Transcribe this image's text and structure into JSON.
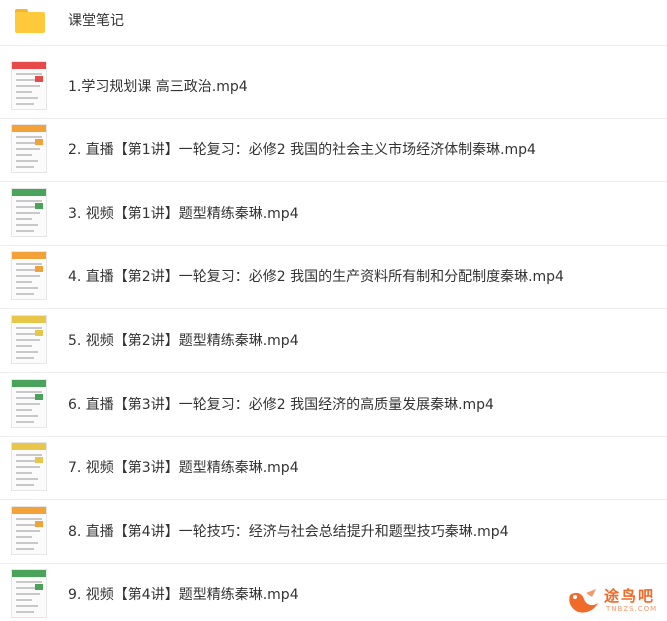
{
  "folder": {
    "name": "课堂笔记",
    "icon": "folder-icon",
    "color": "#ffc93c"
  },
  "files": [
    {
      "name": "1.学习规划课 高三政治.mp4",
      "icon": "video-thumbnail-icon",
      "accent": "#e84a4a"
    },
    {
      "name": "2. 直播【第1讲】一轮复习：必修2 我国的社会主义市场经济体制秦琳.mp4",
      "icon": "video-thumbnail-icon",
      "accent": "#f3a23a"
    },
    {
      "name": "3. 视频【第1讲】题型精练秦琳.mp4",
      "icon": "video-thumbnail-icon",
      "accent": "#4aa35a"
    },
    {
      "name": "4. 直播【第2讲】一轮复习：必修2 我国的生产资料所有制和分配制度秦琳.mp4",
      "icon": "video-thumbnail-icon",
      "accent": "#f3a23a"
    },
    {
      "name": "5. 视频【第2讲】题型精练秦琳.mp4",
      "icon": "video-thumbnail-icon",
      "accent": "#e8c64a"
    },
    {
      "name": "6. 直播【第3讲】一轮复习：必修2 我国经济的高质量发展秦琳.mp4",
      "icon": "video-thumbnail-icon",
      "accent": "#4aa35a"
    },
    {
      "name": "7. 视频【第3讲】题型精练秦琳.mp4",
      "icon": "video-thumbnail-icon",
      "accent": "#e8c64a"
    },
    {
      "name": "8. 直播【第4讲】一轮技巧：经济与社会总结提升和题型技巧秦琳.mp4",
      "icon": "video-thumbnail-icon",
      "accent": "#f3a23a"
    },
    {
      "name": "9. 视频【第4讲】题型精练秦琳.mp4",
      "icon": "video-thumbnail-icon",
      "accent": "#4aa35a"
    }
  ],
  "watermark": {
    "text": "途鸟吧",
    "sub": "TNBZS.COM",
    "icon": "bird-logo-icon",
    "color": "#f06a2a"
  }
}
